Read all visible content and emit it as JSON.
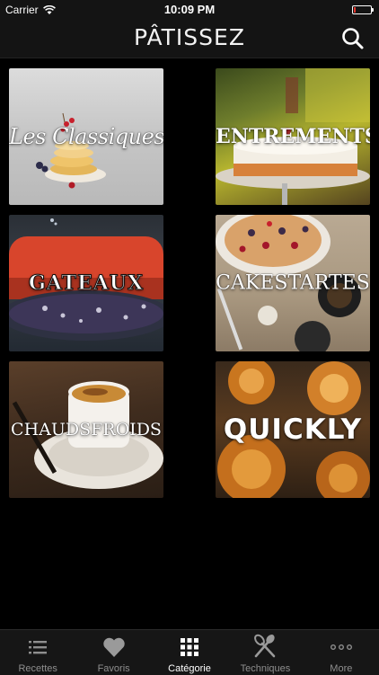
{
  "status_bar": {
    "carrier": "Carrier",
    "time": "10:09 PM",
    "battery_color": "#e2342c",
    "battery_level": 0.12
  },
  "nav": {
    "title": "PÂTISSEZ",
    "search_icon": "search-icon"
  },
  "categories": [
    {
      "label": "Les Classiques",
      "style": "script"
    },
    {
      "label": "ENTREMENTS",
      "style": "bold"
    },
    {
      "label": "GATEAUX",
      "style": "slab"
    },
    {
      "label": "CAKESTARTES",
      "style": "thin"
    },
    {
      "label": "CHAUDSFROIDS",
      "style": "chaud"
    },
    {
      "label": "QUICKLY",
      "style": "quick"
    }
  ],
  "tabs": [
    {
      "label": "Recettes",
      "icon": "list-icon",
      "active": false
    },
    {
      "label": "Favoris",
      "icon": "heart-icon",
      "active": false
    },
    {
      "label": "Catégorie",
      "icon": "grid-icon",
      "active": true
    },
    {
      "label": "Techniques",
      "icon": "whisk-spatula-icon",
      "active": false
    },
    {
      "label": "More",
      "icon": "more-icon",
      "active": false
    }
  ],
  "colors": {
    "background": "#000000",
    "bar": "#141414",
    "tab_active": "#ffffff",
    "tab_inactive": "#8e8e8e"
  }
}
